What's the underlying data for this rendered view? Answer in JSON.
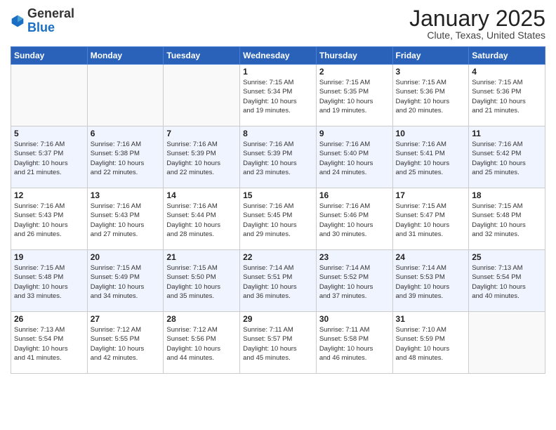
{
  "header": {
    "logo_general": "General",
    "logo_blue": "Blue",
    "month_title": "January 2025",
    "location": "Clute, Texas, United States"
  },
  "days_of_week": [
    "Sunday",
    "Monday",
    "Tuesday",
    "Wednesday",
    "Thursday",
    "Friday",
    "Saturday"
  ],
  "weeks": [
    [
      {
        "day": "",
        "info": ""
      },
      {
        "day": "",
        "info": ""
      },
      {
        "day": "",
        "info": ""
      },
      {
        "day": "1",
        "info": "Sunrise: 7:15 AM\nSunset: 5:34 PM\nDaylight: 10 hours\nand 19 minutes."
      },
      {
        "day": "2",
        "info": "Sunrise: 7:15 AM\nSunset: 5:35 PM\nDaylight: 10 hours\nand 19 minutes."
      },
      {
        "day": "3",
        "info": "Sunrise: 7:15 AM\nSunset: 5:36 PM\nDaylight: 10 hours\nand 20 minutes."
      },
      {
        "day": "4",
        "info": "Sunrise: 7:15 AM\nSunset: 5:36 PM\nDaylight: 10 hours\nand 21 minutes."
      }
    ],
    [
      {
        "day": "5",
        "info": "Sunrise: 7:16 AM\nSunset: 5:37 PM\nDaylight: 10 hours\nand 21 minutes."
      },
      {
        "day": "6",
        "info": "Sunrise: 7:16 AM\nSunset: 5:38 PM\nDaylight: 10 hours\nand 22 minutes."
      },
      {
        "day": "7",
        "info": "Sunrise: 7:16 AM\nSunset: 5:39 PM\nDaylight: 10 hours\nand 22 minutes."
      },
      {
        "day": "8",
        "info": "Sunrise: 7:16 AM\nSunset: 5:39 PM\nDaylight: 10 hours\nand 23 minutes."
      },
      {
        "day": "9",
        "info": "Sunrise: 7:16 AM\nSunset: 5:40 PM\nDaylight: 10 hours\nand 24 minutes."
      },
      {
        "day": "10",
        "info": "Sunrise: 7:16 AM\nSunset: 5:41 PM\nDaylight: 10 hours\nand 25 minutes."
      },
      {
        "day": "11",
        "info": "Sunrise: 7:16 AM\nSunset: 5:42 PM\nDaylight: 10 hours\nand 25 minutes."
      }
    ],
    [
      {
        "day": "12",
        "info": "Sunrise: 7:16 AM\nSunset: 5:43 PM\nDaylight: 10 hours\nand 26 minutes."
      },
      {
        "day": "13",
        "info": "Sunrise: 7:16 AM\nSunset: 5:43 PM\nDaylight: 10 hours\nand 27 minutes."
      },
      {
        "day": "14",
        "info": "Sunrise: 7:16 AM\nSunset: 5:44 PM\nDaylight: 10 hours\nand 28 minutes."
      },
      {
        "day": "15",
        "info": "Sunrise: 7:16 AM\nSunset: 5:45 PM\nDaylight: 10 hours\nand 29 minutes."
      },
      {
        "day": "16",
        "info": "Sunrise: 7:16 AM\nSunset: 5:46 PM\nDaylight: 10 hours\nand 30 minutes."
      },
      {
        "day": "17",
        "info": "Sunrise: 7:15 AM\nSunset: 5:47 PM\nDaylight: 10 hours\nand 31 minutes."
      },
      {
        "day": "18",
        "info": "Sunrise: 7:15 AM\nSunset: 5:48 PM\nDaylight: 10 hours\nand 32 minutes."
      }
    ],
    [
      {
        "day": "19",
        "info": "Sunrise: 7:15 AM\nSunset: 5:48 PM\nDaylight: 10 hours\nand 33 minutes."
      },
      {
        "day": "20",
        "info": "Sunrise: 7:15 AM\nSunset: 5:49 PM\nDaylight: 10 hours\nand 34 minutes."
      },
      {
        "day": "21",
        "info": "Sunrise: 7:15 AM\nSunset: 5:50 PM\nDaylight: 10 hours\nand 35 minutes."
      },
      {
        "day": "22",
        "info": "Sunrise: 7:14 AM\nSunset: 5:51 PM\nDaylight: 10 hours\nand 36 minutes."
      },
      {
        "day": "23",
        "info": "Sunrise: 7:14 AM\nSunset: 5:52 PM\nDaylight: 10 hours\nand 37 minutes."
      },
      {
        "day": "24",
        "info": "Sunrise: 7:14 AM\nSunset: 5:53 PM\nDaylight: 10 hours\nand 39 minutes."
      },
      {
        "day": "25",
        "info": "Sunrise: 7:13 AM\nSunset: 5:54 PM\nDaylight: 10 hours\nand 40 minutes."
      }
    ],
    [
      {
        "day": "26",
        "info": "Sunrise: 7:13 AM\nSunset: 5:54 PM\nDaylight: 10 hours\nand 41 minutes."
      },
      {
        "day": "27",
        "info": "Sunrise: 7:12 AM\nSunset: 5:55 PM\nDaylight: 10 hours\nand 42 minutes."
      },
      {
        "day": "28",
        "info": "Sunrise: 7:12 AM\nSunset: 5:56 PM\nDaylight: 10 hours\nand 44 minutes."
      },
      {
        "day": "29",
        "info": "Sunrise: 7:11 AM\nSunset: 5:57 PM\nDaylight: 10 hours\nand 45 minutes."
      },
      {
        "day": "30",
        "info": "Sunrise: 7:11 AM\nSunset: 5:58 PM\nDaylight: 10 hours\nand 46 minutes."
      },
      {
        "day": "31",
        "info": "Sunrise: 7:10 AM\nSunset: 5:59 PM\nDaylight: 10 hours\nand 48 minutes."
      },
      {
        "day": "",
        "info": ""
      }
    ]
  ]
}
